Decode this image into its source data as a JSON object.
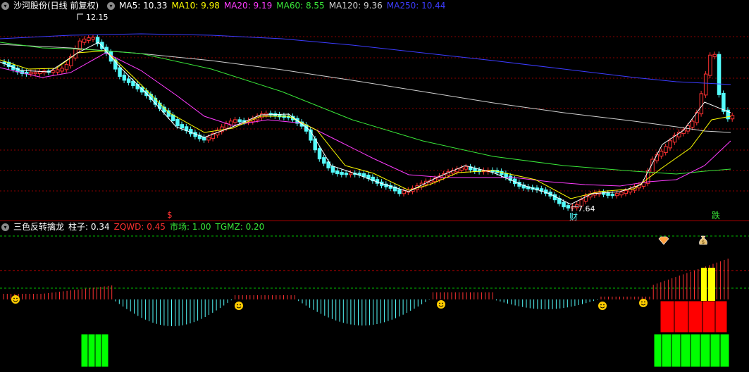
{
  "main_header": {
    "title": "沙河股份(日线 前复权)",
    "ma": [
      {
        "label": "MA5: 10.33",
        "color": "#ffffff"
      },
      {
        "label": "MA10: 9.98",
        "color": "#ffff00"
      },
      {
        "label": "MA20: 9.19",
        "color": "#ff3cff"
      },
      {
        "label": "MA60: 8.55",
        "color": "#39e639"
      },
      {
        "label": "MA120: 9.36",
        "color": "#d0d0d0"
      },
      {
        "label": "MA250: 10.44",
        "color": "#3c3cff"
      }
    ]
  },
  "indicator_header": {
    "title": "三色反转擒龙",
    "items": [
      {
        "label": "柱子: 0.34",
        "color": "#ffffff"
      },
      {
        "label": "ZQWD: 0.45",
        "color": "#ff3030"
      },
      {
        "label": "市场: 1.00",
        "color": "#39e639"
      },
      {
        "label": "TGMZ: 0.20",
        "color": "#39e639"
      }
    ]
  },
  "annotations": {
    "high_price": "12.15",
    "low_price": "7.64",
    "tag_dollar": "$",
    "tag_cai": "财",
    "tag_die": "跌"
  },
  "colors": {
    "up": "#ff3232",
    "down": "#54fcfc",
    "grid": "#8b0000",
    "ma5": "#ffffff",
    "ma10": "#ffff00",
    "ma20": "#ff3cff",
    "ma60": "#39e639",
    "ma120": "#d0d0d0",
    "ma250": "#3c3cff",
    "green_bar": "#00ff00",
    "red_bar": "#ff0000",
    "yellow_bar": "#ffff00"
  },
  "icons": [
    "chevron-down-icon",
    "smiley-icon",
    "diamond-icon",
    "money-bag-icon"
  ]
}
